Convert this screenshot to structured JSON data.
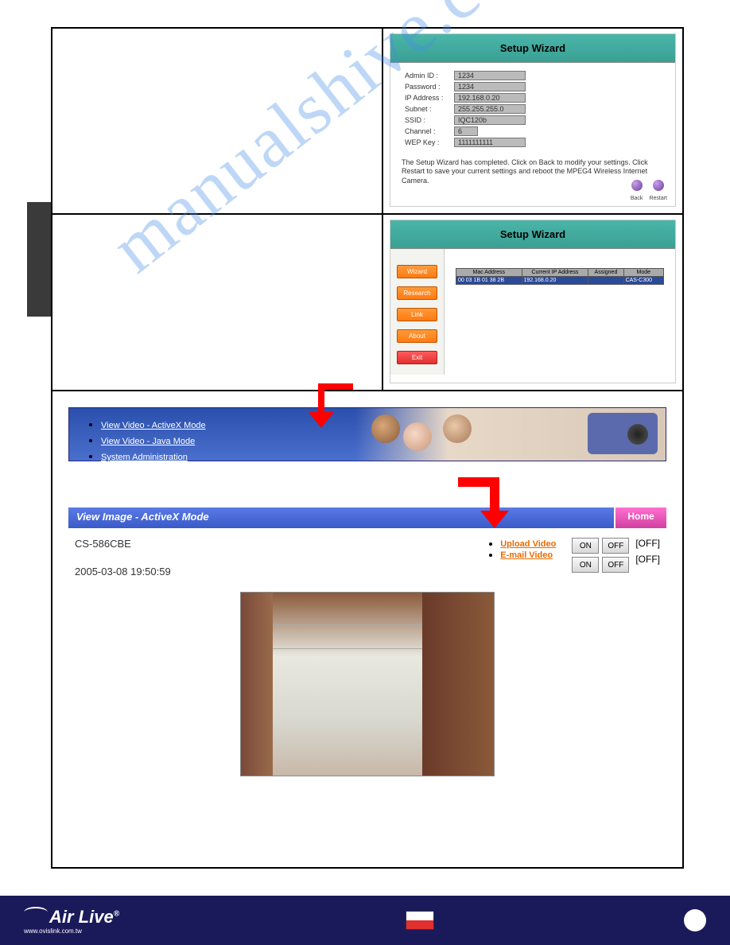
{
  "watermark": "manualshive.com",
  "wizard1": {
    "title": "Setup Wizard",
    "fields": {
      "admin_id": {
        "label": "Admin ID :",
        "value": "1234"
      },
      "password": {
        "label": "Password :",
        "value": "1234"
      },
      "ip": {
        "label": "IP Address :",
        "value": "192.168.0.20"
      },
      "subnet": {
        "label": "Subnet :",
        "value": "255.255.255.0"
      },
      "ssid": {
        "label": "SSID :",
        "value": "IQC120b"
      },
      "channel": {
        "label": "Channel :",
        "value": "6"
      },
      "wep": {
        "label": "WEP Key :",
        "value": "1111111111"
      }
    },
    "message": "The Setup Wizard has completed. Click on Back to modify your settings. Click Restart to save your current settings and reboot the MPEG4 Wireless Internet Camera.",
    "back_label": "Back",
    "restart_label": "Restart"
  },
  "wizard2": {
    "title": "Setup Wizard",
    "sidebar": {
      "wizard": "Wizard",
      "research": "Research",
      "link": "Link",
      "about": "About",
      "exit": "Exit"
    },
    "table": {
      "headers": {
        "mac": "Mac Address",
        "ip": "Current IP Address",
        "assigned": "Assigned",
        "mode": "Mode"
      },
      "row": {
        "mac": "00 03 1B 01 38 2B",
        "ip": "192.168.0.20",
        "assigned": "",
        "mode": "CAS-C300"
      }
    }
  },
  "nav": {
    "link1": "View Video - ActiveX Mode",
    "link2": "View Video - Java Mode",
    "link3": "System Administration"
  },
  "viewbar": {
    "title": "View Image - ActiveX Mode",
    "home": "Home"
  },
  "info": {
    "camera_name": "CS-586CBE",
    "timestamp": "2005-03-08 19:50:59",
    "upload_link": "Upload Video",
    "email_link": "E-mail Video",
    "on": "ON",
    "off": "OFF",
    "status_off": "[OFF]"
  },
  "footer": {
    "brand": "Air Live",
    "url": "www.ovislink.com.tw"
  }
}
